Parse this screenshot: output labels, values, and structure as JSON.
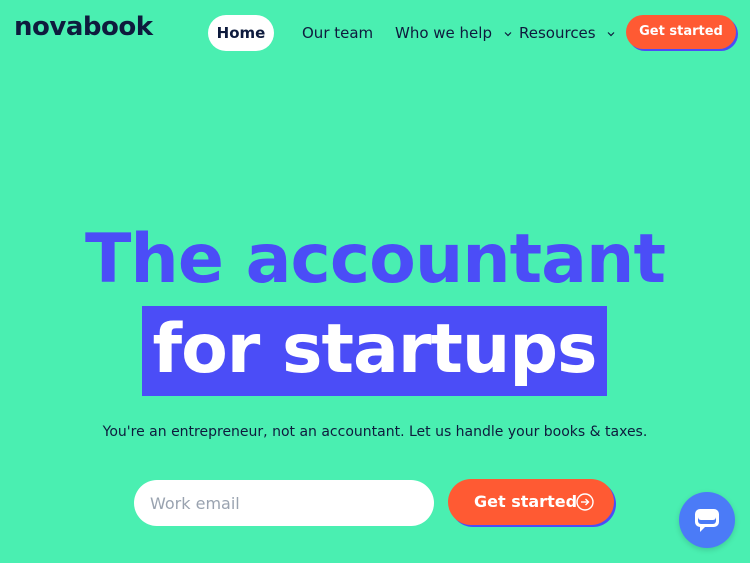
{
  "header": {
    "logo": "novabook",
    "nav": {
      "home": "Home",
      "team": "Our team",
      "who": "Who we help",
      "resources": "Resources",
      "cta": "Get started"
    }
  },
  "hero": {
    "line1": "The accountant",
    "line2": "for startups",
    "subtitle": "You're an entrepreneur, not an accountant. Let us handle your books & taxes.",
    "email_placeholder": "Work email",
    "cta": "Get started"
  },
  "icons": {
    "who_chevron": "chevron-down-icon",
    "resources_chevron": "chevron-down-icon",
    "cta_arrow": "arrow-right-circle-icon",
    "chat": "chat-bubble-icon"
  },
  "colors": {
    "background": "#4AEFB1",
    "accent_blue": "#4B4DF7",
    "cta_orange": "#FF5A33",
    "text_dark": "#0E1B3D",
    "chat_blue": "#4B7BF7"
  }
}
